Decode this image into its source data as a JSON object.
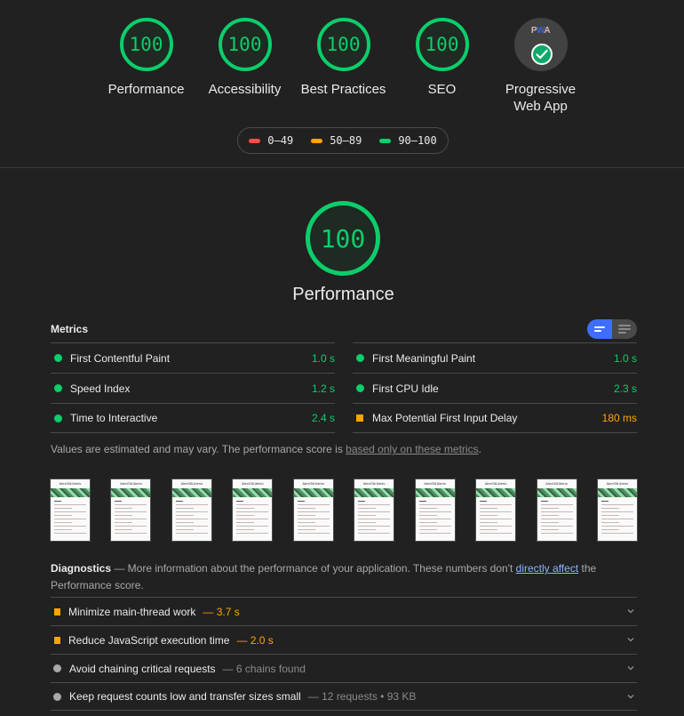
{
  "colors": {
    "pass": "#0cce6b",
    "average": "#ffa400",
    "fail": "#ff4e42",
    "informative": "#a8a8a8",
    "link": "#8ab4f8",
    "toggle_active": "#3d6eff"
  },
  "categories": [
    {
      "label": "Performance",
      "score": "100"
    },
    {
      "label": "Accessibility",
      "score": "100"
    },
    {
      "label": "Best Practices",
      "score": "100"
    },
    {
      "label": "SEO",
      "score": "100"
    },
    {
      "label_line1": "Progressive",
      "label_line2": "Web App",
      "badge_text_p": "P",
      "badge_text_w": "W",
      "badge_text_a": "A",
      "badge_icon": "check-icon"
    }
  ],
  "legend": [
    {
      "range": "0–49",
      "color": "#ff4e42"
    },
    {
      "range": "50–89",
      "color": "#ffa400"
    },
    {
      "range": "90–100",
      "color": "#0cce6b"
    }
  ],
  "performance": {
    "score": "100",
    "title": "Performance"
  },
  "metrics": {
    "header": "Metrics",
    "toggle": {
      "compact_icon": "compact-view-icon",
      "expanded_icon": "expanded-view-icon",
      "active": "compact"
    },
    "items": [
      {
        "label": "First Contentful Paint",
        "value": "1.0 s",
        "status": "pass"
      },
      {
        "label": "First Meaningful Paint",
        "value": "1.0 s",
        "status": "pass"
      },
      {
        "label": "Speed Index",
        "value": "1.2 s",
        "status": "pass"
      },
      {
        "label": "First CPU Idle",
        "value": "2.3 s",
        "status": "pass"
      },
      {
        "label": "Time to Interactive",
        "value": "2.4 s",
        "status": "pass"
      },
      {
        "label": "Max Potential First Input Delay",
        "value": "180 ms",
        "status": "average"
      }
    ],
    "note_prefix": "Values are estimated and may vary. The performance score is ",
    "note_link": "based only on these metrics",
    "note_suffix": "."
  },
  "filmstrip": {
    "frame_count": 10,
    "frame_title": "AlexGilLiberio"
  },
  "diagnostics": {
    "title": "Diagnostics",
    "desc_prefix": " — More information about the performance of your application. These numbers don't ",
    "desc_link": "directly affect",
    "desc_suffix": " the Performance score.",
    "items": [
      {
        "label": "Minimize main-thread work",
        "display": "— 3.7 s",
        "status": "average"
      },
      {
        "label": "Reduce JavaScript execution time",
        "display": "— 2.0 s",
        "status": "average"
      },
      {
        "label": "Avoid chaining critical requests",
        "display": "— 6 chains found",
        "status": "informative"
      },
      {
        "label": "Keep request counts low and transfer sizes small",
        "display": "— 12 requests • 93 KB",
        "status": "informative"
      }
    ]
  }
}
